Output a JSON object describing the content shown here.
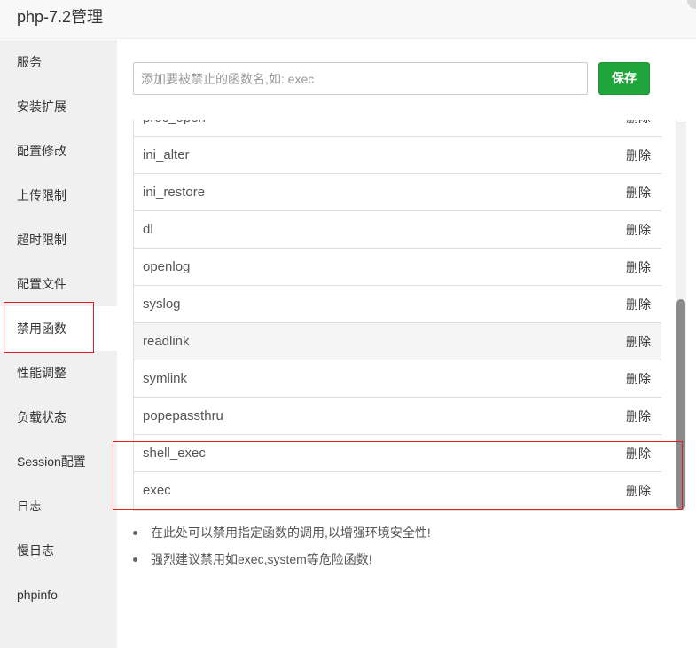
{
  "window": {
    "title": "php-7.2管理"
  },
  "sidebar": {
    "items": [
      {
        "label": "服务"
      },
      {
        "label": "安装扩展"
      },
      {
        "label": "配置修改"
      },
      {
        "label": "上传限制"
      },
      {
        "label": "超时限制"
      },
      {
        "label": "配置文件"
      },
      {
        "label": "禁用函数",
        "active": true
      },
      {
        "label": "性能调整"
      },
      {
        "label": "负载状态"
      },
      {
        "label": "Session配置"
      },
      {
        "label": "日志"
      },
      {
        "label": "慢日志"
      },
      {
        "label": "phpinfo"
      }
    ]
  },
  "main": {
    "search": {
      "placeholder": "添加要被禁止的函数名,如: exec",
      "value": ""
    },
    "save_label": "保存",
    "delete_label": "删除",
    "functions": [
      {
        "name": "proc_open"
      },
      {
        "name": "ini_alter"
      },
      {
        "name": "ini_restore"
      },
      {
        "name": "dl"
      },
      {
        "name": "openlog"
      },
      {
        "name": "syslog"
      },
      {
        "name": "readlink",
        "hover": true
      },
      {
        "name": "symlink"
      },
      {
        "name": "popepassthru"
      },
      {
        "name": "shell_exec"
      },
      {
        "name": "exec"
      }
    ],
    "tips": [
      "在此处可以禁用指定函数的调用,以增强环境安全性!",
      "强烈建议禁用如exec,system等危险函数!"
    ]
  },
  "colors": {
    "accent": "#20a53a",
    "highlight_border": "#e02020",
    "sidebar_bg": "#f0f0f0"
  }
}
